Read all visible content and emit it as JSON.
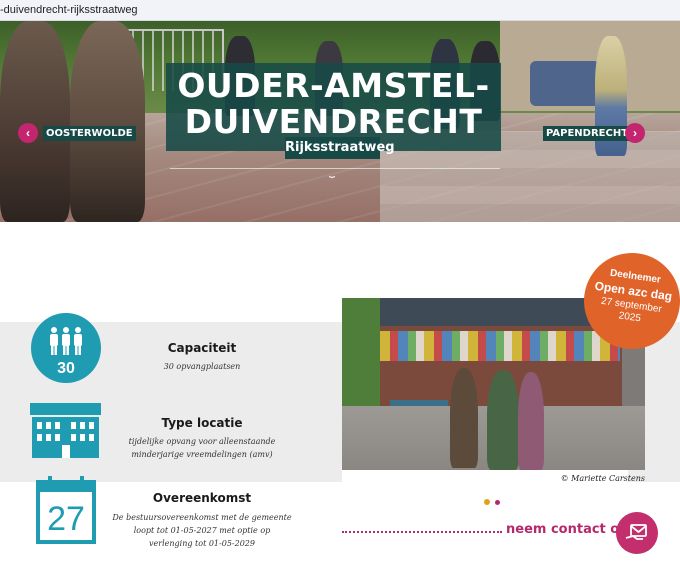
{
  "browser": {
    "url": "-duivendrecht-rijksstraatweg"
  },
  "hero": {
    "title_line1": "OUDER-AMSTEL-",
    "title_line2": "DUIVENDRECHT",
    "subtitle": "Rijksstraatweg",
    "prev_label": "OOSTERWOLDE",
    "next_label": "PAPENDRECHT"
  },
  "info": {
    "capacity": {
      "icon_value": "30",
      "title": "Capaciteit",
      "text": "30 opvangplaatsen"
    },
    "location": {
      "title": "Type locatie",
      "text_line1": "tijdelijke opvang voor alleenstaande",
      "text_line2": "minderjarige vreemdelingen (amv)"
    },
    "agreement": {
      "icon_value": "27",
      "title": "Overeenkomst",
      "text_line1": "De bestuursovereenkomst met de gemeente",
      "text_line2": "loopt tot 01-05-2027 met optie op",
      "text_line3": "verlenging tot 01-05-2029"
    }
  },
  "photo": {
    "caption": "© Mariette Carstens"
  },
  "badge": {
    "line1": "Deelnemer",
    "line2": "Open azc dag",
    "line3": "27 september",
    "line4": "2025"
  },
  "contact": {
    "label": "neem contact op"
  },
  "colors": {
    "teal": "#174a47",
    "accent": "#c3266f",
    "icon_blue": "#1f9bb2",
    "badge": "#e0632a"
  }
}
